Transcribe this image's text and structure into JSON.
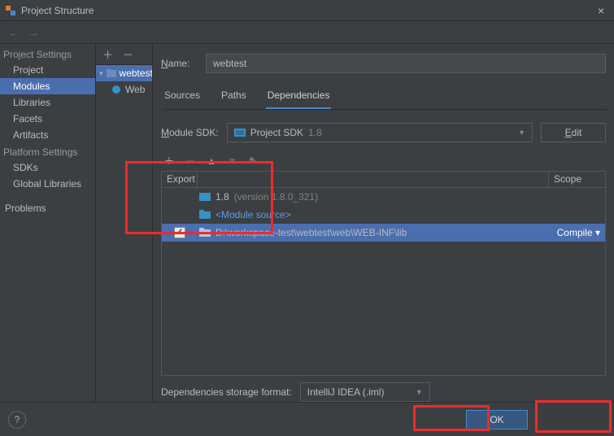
{
  "window": {
    "title": "Project Structure",
    "close": "×"
  },
  "nav": {
    "back": "←",
    "fwd": "→"
  },
  "sidebar": {
    "group1": "Project Settings",
    "items1": [
      "Project",
      "Modules",
      "Libraries",
      "Facets",
      "Artifacts"
    ],
    "group2": "Platform Settings",
    "items2": [
      "SDKs",
      "Global Libraries"
    ],
    "problems": "Problems"
  },
  "tree": {
    "tool_add": "＋",
    "tool_minus": "－",
    "root": "webtest",
    "child": "Web"
  },
  "main": {
    "name_label": "Name:",
    "name_value": "webtest",
    "tabs": [
      "Sources",
      "Paths",
      "Dependencies"
    ],
    "sdk_label": "Module SDK:",
    "sdk_value": "Project SDK ",
    "sdk_ver": "1.8",
    "edit": "Edit",
    "tool": {
      "add": "＋",
      "minus": "－",
      "up": "▲",
      "down": "▼",
      "pen": "✎"
    },
    "export_h": "Export",
    "scope_h": "Scope",
    "deps": [
      {
        "label": "1.8 ",
        "dim": "(version 1.8.0_321)",
        "icon": "sdk"
      },
      {
        "label": "<Module source>",
        "icon": "src",
        "link": true
      },
      {
        "label": "D:\\workspace-test\\webtest\\web\\WEB-INF\\lib",
        "icon": "folder",
        "checked": true,
        "sel": true,
        "scope": "Compile ▾"
      }
    ],
    "storage_label": "Dependencies storage format:",
    "storage_value": "IntelliJ IDEA (.iml)"
  },
  "footer": {
    "help": "?",
    "ok": "OK"
  }
}
